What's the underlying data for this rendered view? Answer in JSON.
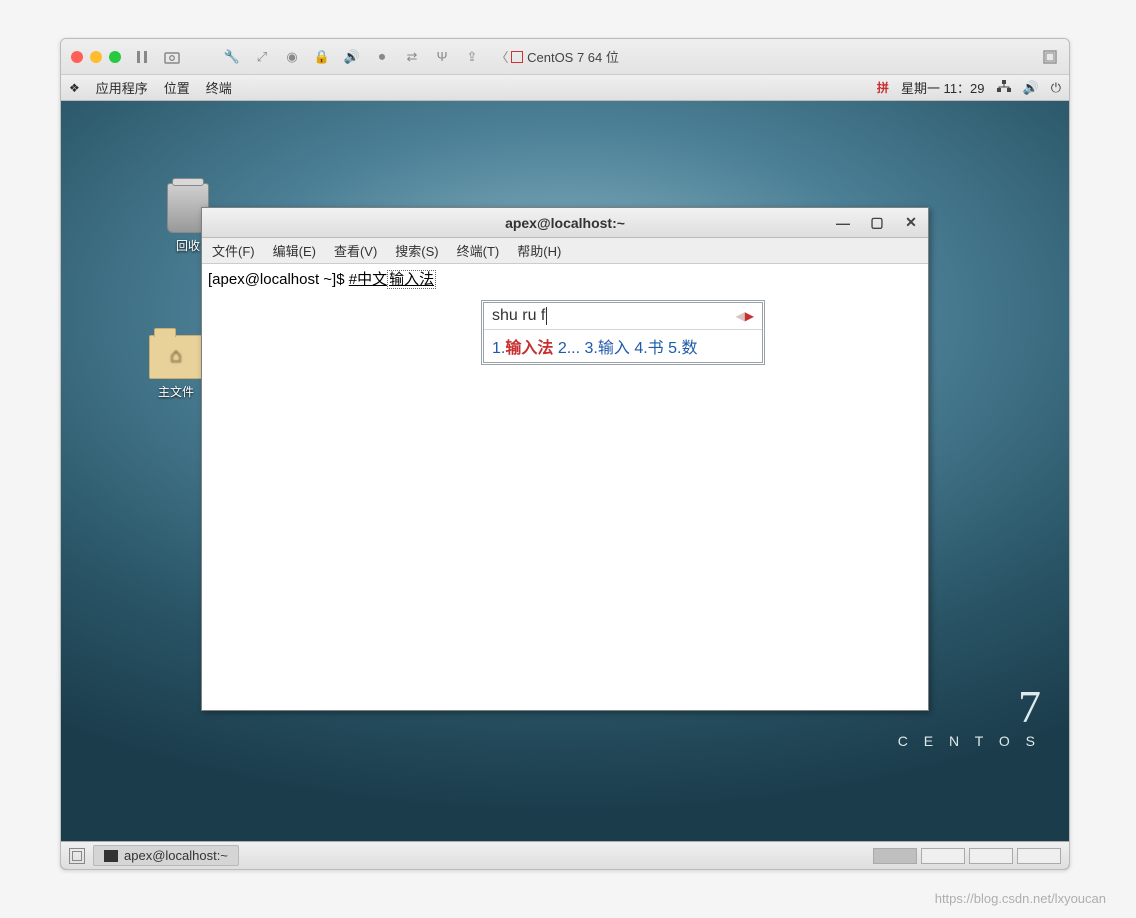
{
  "host": {
    "title": "CentOS 7 64 位"
  },
  "guest_panel": {
    "apps": "应用程序",
    "places": "位置",
    "terminal": "终端",
    "ime": "拼",
    "datetime": "星期一 11：29"
  },
  "desktop": {
    "trash": "回收",
    "home": "主文件"
  },
  "centos": {
    "seven": "7",
    "word": "C E N T O S"
  },
  "terminal": {
    "title": "apex@localhost:~",
    "menu": {
      "file": "文件(F)",
      "edit": "编辑(E)",
      "view": "查看(V)",
      "search": "搜索(S)",
      "term": "终端(T)",
      "help": "帮助(H)"
    },
    "prompt": "[apex@localhost ~]$ ",
    "typed_prefix": "#中文",
    "preedit": "输入法"
  },
  "ime": {
    "input": "shu ru f",
    "candidates": [
      {
        "n": "1.",
        "t": "输入法",
        "sel": true
      },
      {
        "n": "2",
        "t": "..."
      },
      {
        "n": "3.",
        "t": "输入"
      },
      {
        "n": "4.",
        "t": "书"
      },
      {
        "n": "5.",
        "t": "数"
      }
    ]
  },
  "taskbar": {
    "task": "apex@localhost:~"
  },
  "watermark": "https://blog.csdn.net/lxyoucan"
}
